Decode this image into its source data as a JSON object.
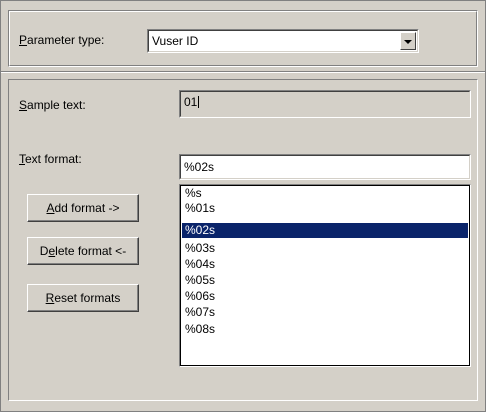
{
  "parameter_type": {
    "label_underlined": "P",
    "label_rest": "arameter type:",
    "value": "Vuser ID"
  },
  "sample_text": {
    "label_underlined": "S",
    "label_rest": "ample text:",
    "value": "01"
  },
  "text_format": {
    "label_underlined": "T",
    "label_rest": "ext format:",
    "value": "%02s"
  },
  "buttons": {
    "add_format": {
      "pre": "",
      "underlined": "A",
      "post": "dd format ->"
    },
    "delete_format": {
      "pre": "D",
      "underlined": "e",
      "post": "lete format <-"
    },
    "reset_formats": {
      "pre": "",
      "underlined": "R",
      "post": "eset formats"
    }
  },
  "format_list": {
    "items": [
      "%s",
      "%01s",
      "%02s",
      "%03s",
      "%04s",
      "%05s",
      "%06s",
      "%07s",
      "%08s"
    ],
    "selected_index": 2
  },
  "colors": {
    "dialog_bg": "#d4d0c8",
    "selection_bg": "#0a246a",
    "selection_fg": "#ffffff"
  }
}
